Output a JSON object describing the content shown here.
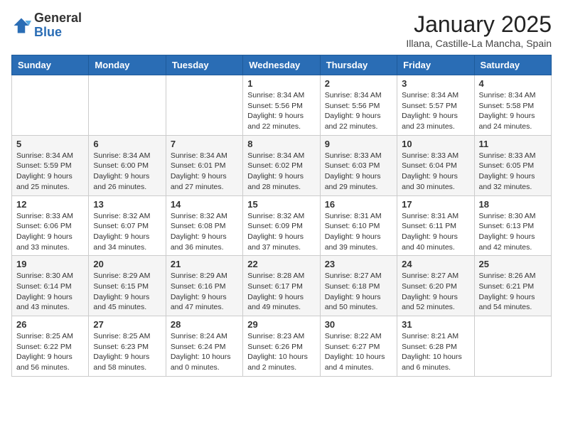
{
  "header": {
    "logo_general": "General",
    "logo_blue": "Blue",
    "month_title": "January 2025",
    "subtitle": "Illana, Castille-La Mancha, Spain"
  },
  "days_of_week": [
    "Sunday",
    "Monday",
    "Tuesday",
    "Wednesday",
    "Thursday",
    "Friday",
    "Saturday"
  ],
  "weeks": [
    [
      {
        "day": "",
        "content": ""
      },
      {
        "day": "",
        "content": ""
      },
      {
        "day": "",
        "content": ""
      },
      {
        "day": "1",
        "content": "Sunrise: 8:34 AM\nSunset: 5:56 PM\nDaylight: 9 hours\nand 22 minutes."
      },
      {
        "day": "2",
        "content": "Sunrise: 8:34 AM\nSunset: 5:56 PM\nDaylight: 9 hours\nand 22 minutes."
      },
      {
        "day": "3",
        "content": "Sunrise: 8:34 AM\nSunset: 5:57 PM\nDaylight: 9 hours\nand 23 minutes."
      },
      {
        "day": "4",
        "content": "Sunrise: 8:34 AM\nSunset: 5:58 PM\nDaylight: 9 hours\nand 24 minutes."
      }
    ],
    [
      {
        "day": "5",
        "content": "Sunrise: 8:34 AM\nSunset: 5:59 PM\nDaylight: 9 hours\nand 25 minutes."
      },
      {
        "day": "6",
        "content": "Sunrise: 8:34 AM\nSunset: 6:00 PM\nDaylight: 9 hours\nand 26 minutes."
      },
      {
        "day": "7",
        "content": "Sunrise: 8:34 AM\nSunset: 6:01 PM\nDaylight: 9 hours\nand 27 minutes."
      },
      {
        "day": "8",
        "content": "Sunrise: 8:34 AM\nSunset: 6:02 PM\nDaylight: 9 hours\nand 28 minutes."
      },
      {
        "day": "9",
        "content": "Sunrise: 8:33 AM\nSunset: 6:03 PM\nDaylight: 9 hours\nand 29 minutes."
      },
      {
        "day": "10",
        "content": "Sunrise: 8:33 AM\nSunset: 6:04 PM\nDaylight: 9 hours\nand 30 minutes."
      },
      {
        "day": "11",
        "content": "Sunrise: 8:33 AM\nSunset: 6:05 PM\nDaylight: 9 hours\nand 32 minutes."
      }
    ],
    [
      {
        "day": "12",
        "content": "Sunrise: 8:33 AM\nSunset: 6:06 PM\nDaylight: 9 hours\nand 33 minutes."
      },
      {
        "day": "13",
        "content": "Sunrise: 8:32 AM\nSunset: 6:07 PM\nDaylight: 9 hours\nand 34 minutes."
      },
      {
        "day": "14",
        "content": "Sunrise: 8:32 AM\nSunset: 6:08 PM\nDaylight: 9 hours\nand 36 minutes."
      },
      {
        "day": "15",
        "content": "Sunrise: 8:32 AM\nSunset: 6:09 PM\nDaylight: 9 hours\nand 37 minutes."
      },
      {
        "day": "16",
        "content": "Sunrise: 8:31 AM\nSunset: 6:10 PM\nDaylight: 9 hours\nand 39 minutes."
      },
      {
        "day": "17",
        "content": "Sunrise: 8:31 AM\nSunset: 6:11 PM\nDaylight: 9 hours\nand 40 minutes."
      },
      {
        "day": "18",
        "content": "Sunrise: 8:30 AM\nSunset: 6:13 PM\nDaylight: 9 hours\nand 42 minutes."
      }
    ],
    [
      {
        "day": "19",
        "content": "Sunrise: 8:30 AM\nSunset: 6:14 PM\nDaylight: 9 hours\nand 43 minutes."
      },
      {
        "day": "20",
        "content": "Sunrise: 8:29 AM\nSunset: 6:15 PM\nDaylight: 9 hours\nand 45 minutes."
      },
      {
        "day": "21",
        "content": "Sunrise: 8:29 AM\nSunset: 6:16 PM\nDaylight: 9 hours\nand 47 minutes."
      },
      {
        "day": "22",
        "content": "Sunrise: 8:28 AM\nSunset: 6:17 PM\nDaylight: 9 hours\nand 49 minutes."
      },
      {
        "day": "23",
        "content": "Sunrise: 8:27 AM\nSunset: 6:18 PM\nDaylight: 9 hours\nand 50 minutes."
      },
      {
        "day": "24",
        "content": "Sunrise: 8:27 AM\nSunset: 6:20 PM\nDaylight: 9 hours\nand 52 minutes."
      },
      {
        "day": "25",
        "content": "Sunrise: 8:26 AM\nSunset: 6:21 PM\nDaylight: 9 hours\nand 54 minutes."
      }
    ],
    [
      {
        "day": "26",
        "content": "Sunrise: 8:25 AM\nSunset: 6:22 PM\nDaylight: 9 hours\nand 56 minutes."
      },
      {
        "day": "27",
        "content": "Sunrise: 8:25 AM\nSunset: 6:23 PM\nDaylight: 9 hours\nand 58 minutes."
      },
      {
        "day": "28",
        "content": "Sunrise: 8:24 AM\nSunset: 6:24 PM\nDaylight: 10 hours\nand 0 minutes."
      },
      {
        "day": "29",
        "content": "Sunrise: 8:23 AM\nSunset: 6:26 PM\nDaylight: 10 hours\nand 2 minutes."
      },
      {
        "day": "30",
        "content": "Sunrise: 8:22 AM\nSunset: 6:27 PM\nDaylight: 10 hours\nand 4 minutes."
      },
      {
        "day": "31",
        "content": "Sunrise: 8:21 AM\nSunset: 6:28 PM\nDaylight: 10 hours\nand 6 minutes."
      },
      {
        "day": "",
        "content": ""
      }
    ]
  ]
}
